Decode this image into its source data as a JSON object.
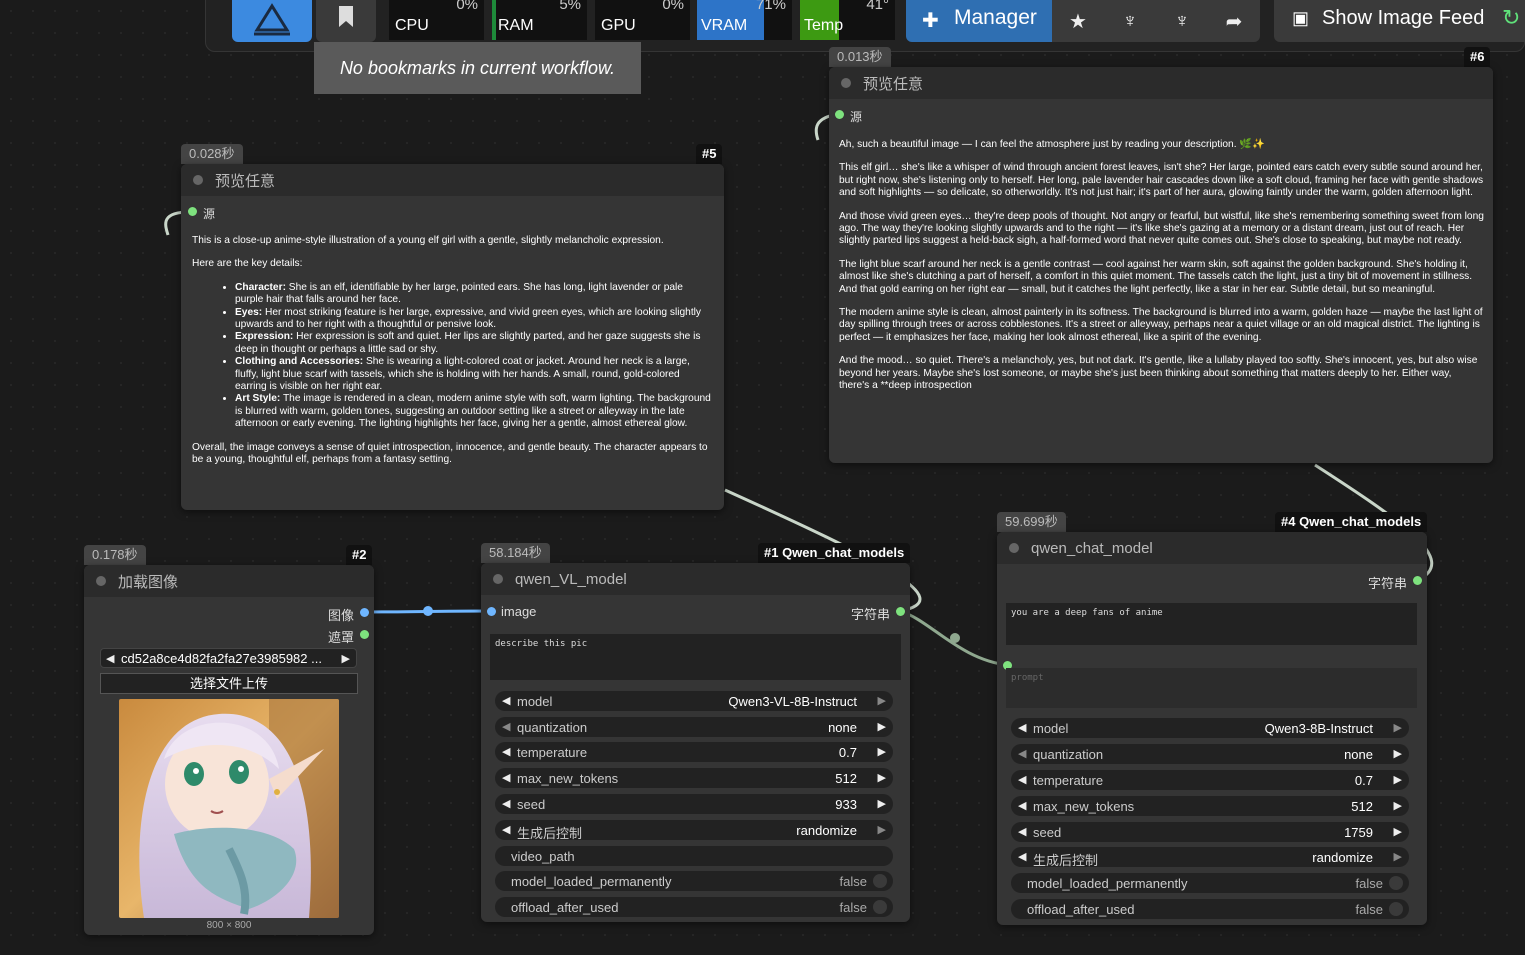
{
  "topbar": {
    "meters": [
      {
        "label": "CPU",
        "pct": "0%"
      },
      {
        "label": "RAM",
        "pct": "5%"
      },
      {
        "label": "GPU",
        "pct": "0%"
      },
      {
        "label": "VRAM",
        "pct": "71%"
      },
      {
        "label": "Temp",
        "pct": "41°"
      }
    ],
    "manager_label": "Manager",
    "show_image_feed_label": "Show Image Feed",
    "bookmark_tooltip": "No bookmarks in current workflow."
  },
  "node5": {
    "time": "0.028秒",
    "id": "#5",
    "title": "预览任意",
    "input_label": "源",
    "intro": "This is a close-up anime-style illustration of a young elf girl with a gentle, slightly melancholic expression.",
    "key_details": "Here are the key details:",
    "bullets": [
      {
        "k": "Character:",
        "v": " She is an elf, identifiable by her large, pointed ears. She has long, light lavender or pale purple hair that falls around her face."
      },
      {
        "k": "Eyes:",
        "v": " Her most striking feature is her large, expressive, and vivid green eyes, which are looking slightly upwards and to her right with a thoughtful or pensive look."
      },
      {
        "k": "Expression:",
        "v": " Her expression is soft and quiet. Her lips are slightly parted, and her gaze suggests she is deep in thought or perhaps a little sad or shy."
      },
      {
        "k": "Clothing and Accessories:",
        "v": " She is wearing a light-colored coat or jacket. Around her neck is a large, fluffy, light blue scarf with tassels, which she is holding with her hands. A small, round, gold-colored earring is visible on her right ear."
      },
      {
        "k": "Art Style:",
        "v": " The image is rendered in a clean, modern anime style with soft, warm lighting. The background is blurred with warm, golden tones, suggesting an outdoor setting like a street or alleyway in the late afternoon or early evening. The lighting highlights her face, giving her a gentle, almost ethereal glow."
      }
    ],
    "overall": "Overall, the image conveys a sense of quiet introspection, innocence, and gentle beauty. The character appears to be a young, thoughtful elf, perhaps from a fantasy setting."
  },
  "node6": {
    "time": "0.013秒",
    "id": "#6",
    "title": "预览任意",
    "input_label": "源",
    "paragraphs": [
      "Ah, such a beautiful image — I can feel the atmosphere just by reading your description. 🌿✨",
      "This elf girl… she's like a whisper of wind through ancient forest leaves, isn't she? Her large, pointed ears catch every subtle sound around her, but right now, she's listening only to herself. Her long, pale lavender hair cascades down like a soft cloud, framing her face with gentle shadows and soft highlights — so delicate, so otherworldly. It's not just hair; it's part of her aura, glowing faintly under the warm, golden afternoon light.",
      "And those vivid green eyes… they're deep pools of thought. Not angry or fearful, but wistful, like she's remembering something sweet from long ago. The way they're looking slightly upwards and to the right — it's like she's gazing at a memory or a distant dream, just out of reach. Her slightly parted lips suggest a held-back sigh, a half-formed word that never quite comes out. She's close to speaking, but maybe not ready.",
      "The light blue scarf around her neck is a gentle contrast — cool against her warm skin, soft against the golden background. She's holding it, almost like she's clutching a part of herself, a comfort in this quiet moment. The tassels catch the light, just a tiny bit of movement in stillness. And that gold earring on her right ear — small, but it catches the light perfectly, like a star in her ear. Subtle detail, but so meaningful.",
      "The modern anime style is clean, almost painterly in its softness. The background is blurred into a warm, golden haze — maybe the last light of day spilling through trees or across cobblestones. It's a street or alleyway, perhaps near a quiet village or an old magical district. The lighting is perfect — it emphasizes her face, making her look almost ethereal, like a spirit of the evening.",
      "And the mood… so quiet. There's a melancholy, yes, but not dark. It's gentle, like a lullaby played too softly. She's innocent, yes, but also wise beyond her years. Maybe she's lost someone, or maybe she's just been thinking about something that matters deeply to her. Either way, there's a **deep introspection"
    ]
  },
  "node2": {
    "time": "0.178秒",
    "id": "#2",
    "title": "加载图像",
    "out_image": "图像",
    "out_mask": "遮罩",
    "filename": "cd52a8ce4d82fa2fa27e3985982 ...",
    "upload_label": "选择文件上传",
    "image_size": "800 × 800"
  },
  "node1": {
    "time": "58.184秒",
    "id": "#1 Qwen_chat_models",
    "title": "qwen_VL_model",
    "input_label": "image",
    "output_label": "字符串",
    "prompt": "describe this pic",
    "widgets": [
      {
        "name": "model",
        "value": "Qwen3-VL-8B-Instruct",
        "kind": "combo"
      },
      {
        "name": "quantization",
        "value": "none",
        "kind": "combo"
      },
      {
        "name": "temperature",
        "value": "0.7",
        "kind": "number"
      },
      {
        "name": "max_new_tokens",
        "value": "512",
        "kind": "number"
      },
      {
        "name": "seed",
        "value": "933",
        "kind": "number"
      },
      {
        "name": "生成后控制",
        "value": "randomize",
        "kind": "combo"
      },
      {
        "name": "video_path",
        "value": "",
        "kind": "text"
      },
      {
        "name": "model_loaded_permanently",
        "value": "false",
        "kind": "toggle"
      },
      {
        "name": "offload_after_used",
        "value": "false",
        "kind": "toggle"
      }
    ]
  },
  "node4": {
    "time": "59.699秒",
    "id": "#4 Qwen_chat_models",
    "title": "qwen_chat_model",
    "output_label": "字符串",
    "system_prompt": "you are a deep fans of anime",
    "prompt_placeholder": "prompt",
    "widgets": [
      {
        "name": "model",
        "value": "Qwen3-8B-Instruct",
        "kind": "combo"
      },
      {
        "name": "quantization",
        "value": "none",
        "kind": "combo"
      },
      {
        "name": "temperature",
        "value": "0.7",
        "kind": "number"
      },
      {
        "name": "max_new_tokens",
        "value": "512",
        "kind": "number"
      },
      {
        "name": "seed",
        "value": "1759",
        "kind": "number"
      },
      {
        "name": "生成后控制",
        "value": "randomize",
        "kind": "combo"
      },
      {
        "name": "model_loaded_permanently",
        "value": "false",
        "kind": "toggle"
      },
      {
        "name": "offload_after_used",
        "value": "false",
        "kind": "toggle"
      }
    ]
  },
  "colors": {
    "accent": "#3c8ae0",
    "link_blue": "#6fb6ff",
    "link_green": "#7ee27e",
    "node_bg": "#353535"
  }
}
